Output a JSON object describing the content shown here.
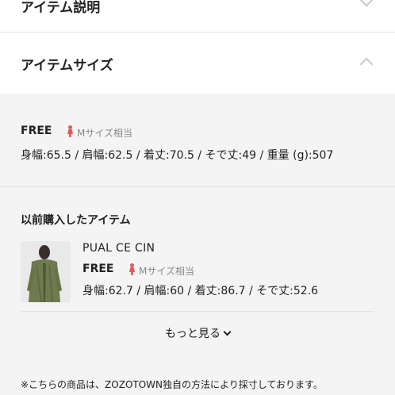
{
  "sections": {
    "item_description": "アイテム説明",
    "item_size": "アイテムサイズ"
  },
  "size_info": {
    "size": "FREE",
    "equivalent": "Mサイズ相当",
    "measurements": "身幅:65.5 / 肩幅:62.5 / 着丈:70.5 / そで丈:49 / 重量 (g):507"
  },
  "previous_purchase": {
    "heading": "以前購入したアイテム",
    "item": {
      "name": "PUAL CE CIN",
      "size": "FREE",
      "equivalent": "Mサイズ相当",
      "measurements": "身幅:62.7 / 肩幅:60 / 着丈:86.7 / そで丈:52.6"
    },
    "more_label": "もっと見る"
  },
  "footnote": "※こちらの商品は、ZOZOTOWN独自の方法により採寸しております。",
  "icons": {
    "person": "person-icon",
    "chevron": "chevron-down-icon"
  },
  "colors": {
    "gray_background": "#f4f4f4",
    "person_icon": "#e45858"
  }
}
